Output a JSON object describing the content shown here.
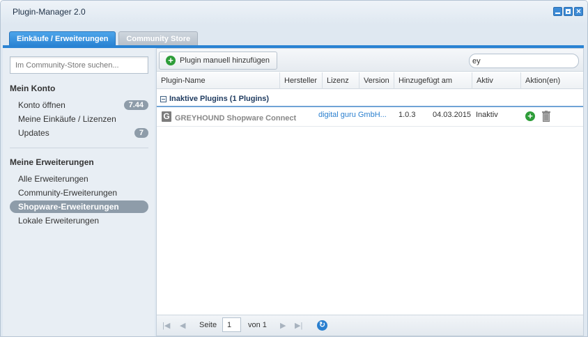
{
  "window": {
    "title": "Plugin-Manager 2.0"
  },
  "tabs": [
    {
      "label": "Einkäufe / Erweiterungen",
      "active": true
    },
    {
      "label": "Community Store",
      "active": false
    }
  ],
  "sidebar": {
    "search_placeholder": "Im Community-Store suchen...",
    "account": {
      "title": "Mein Konto",
      "items": [
        {
          "label": "Konto öffnen",
          "badge": "7.44"
        },
        {
          "label": "Meine Einkäufe / Lizenzen",
          "badge": ""
        },
        {
          "label": "Updates",
          "badge": "7"
        }
      ]
    },
    "extensions": {
      "title": "Meine Erweiterungen",
      "items": [
        {
          "label": "Alle Erweiterungen",
          "active": false
        },
        {
          "label": "Community-Erweiterungen",
          "active": false
        },
        {
          "label": "Shopware-Erweiterungen",
          "active": true
        },
        {
          "label": "Lokale Erweiterungen",
          "active": false
        }
      ]
    }
  },
  "toolbar": {
    "add_button_label": "Plugin manuell hinzufügen",
    "filter_value": "ey"
  },
  "grid": {
    "columns": [
      "Plugin-Name",
      "Hersteller",
      "Lizenz",
      "Version",
      "Hinzugefügt am",
      "Aktiv",
      "Aktion(en)"
    ],
    "group": {
      "label": "Inaktive Plugins (1 Plugins)"
    },
    "rows": [
      {
        "name": "GREYHOUND Shopware Connect",
        "manufacturer": "digital guru GmbH...",
        "version": "1.0.3",
        "added": "04.03.2015",
        "active": "Inaktiv"
      }
    ]
  },
  "paging": {
    "page_label": "Seite",
    "current_page": "1",
    "of_label": "von 1"
  },
  "colors": {
    "accent": "#2a83d3",
    "active_nav": "#8e9ca9",
    "link": "#2a7fcf",
    "success": "#2e9d39"
  }
}
